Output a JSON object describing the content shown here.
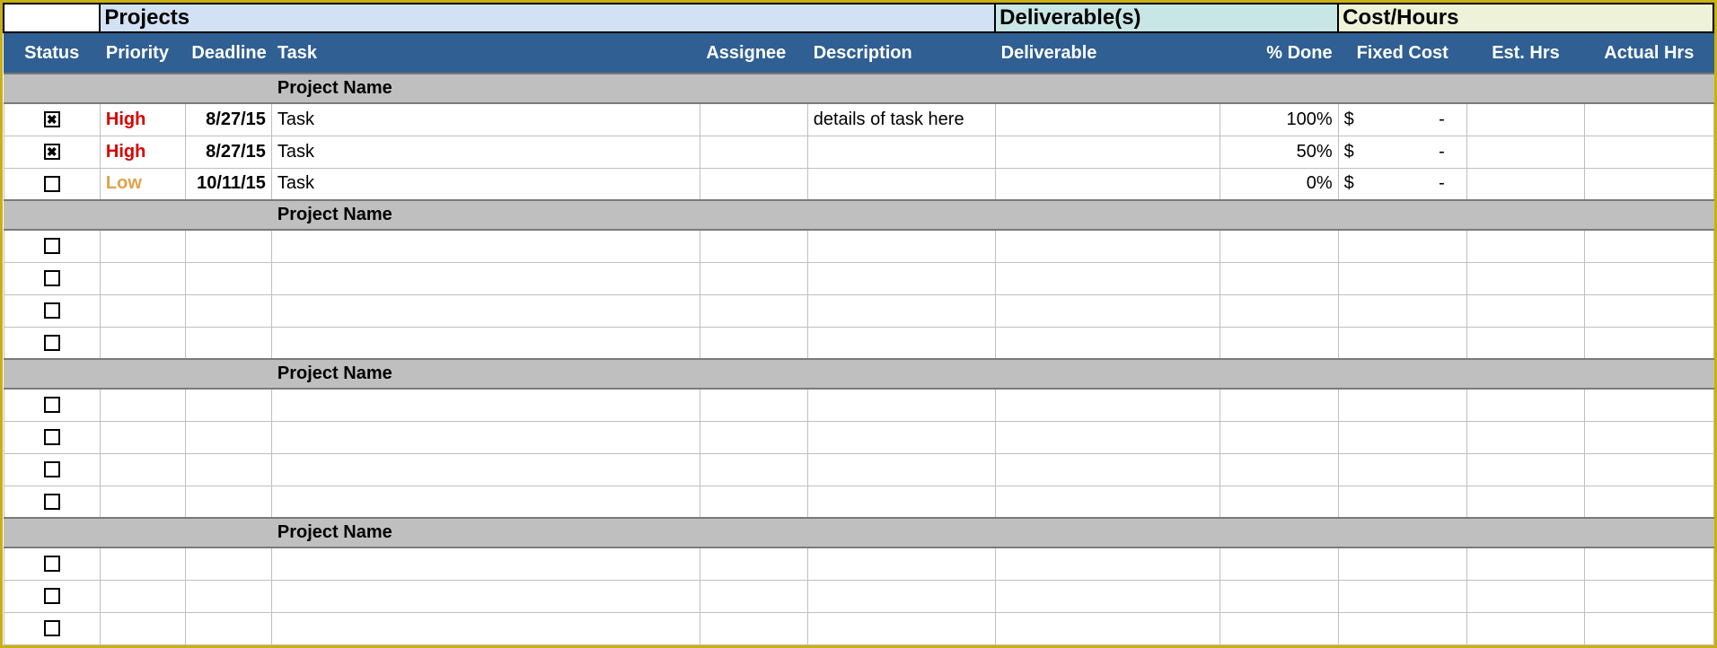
{
  "groupHeaders": {
    "projects": "Projects",
    "deliverables": "Deliverable(s)",
    "cost": "Cost/Hours"
  },
  "columns": {
    "status": "Status",
    "priority": "Priority",
    "deadline": "Deadline",
    "task": "Task",
    "assignee": "Assignee",
    "description": "Description",
    "deliverable": "Deliverable",
    "pctDone": "% Done",
    "fixedCost": "Fixed Cost",
    "estHrs": "Est. Hrs",
    "actualHrs": "Actual Hrs"
  },
  "sections": [
    {
      "name": "Project Name",
      "rows": [
        {
          "status": "checked",
          "priority": "High",
          "priorityClass": "high",
          "deadline": "8/27/15",
          "task": "Task",
          "assignee": "",
          "description": "details of task here",
          "deliverable": "",
          "pctDone": "100%",
          "fixedCurrency": "$",
          "fixedAmount": "-",
          "estHrs": "",
          "actualHrs": ""
        },
        {
          "status": "checked",
          "priority": "High",
          "priorityClass": "high",
          "deadline": "8/27/15",
          "task": "Task",
          "assignee": "",
          "description": "",
          "deliverable": "",
          "pctDone": "50%",
          "fixedCurrency": "$",
          "fixedAmount": "-",
          "estHrs": "",
          "actualHrs": ""
        },
        {
          "status": "unchecked",
          "priority": "Low",
          "priorityClass": "low",
          "deadline": "10/11/15",
          "task": "Task",
          "assignee": "",
          "description": "",
          "deliverable": "",
          "pctDone": "0%",
          "fixedCurrency": "$",
          "fixedAmount": "-",
          "estHrs": "",
          "actualHrs": ""
        }
      ]
    },
    {
      "name": "Project Name",
      "rows": [
        {
          "status": "unchecked",
          "priority": "",
          "priorityClass": "",
          "deadline": "",
          "task": "",
          "assignee": "",
          "description": "",
          "deliverable": "",
          "pctDone": "",
          "fixedCurrency": "",
          "fixedAmount": "",
          "estHrs": "",
          "actualHrs": ""
        },
        {
          "status": "unchecked",
          "priority": "",
          "priorityClass": "",
          "deadline": "",
          "task": "",
          "assignee": "",
          "description": "",
          "deliverable": "",
          "pctDone": "",
          "fixedCurrency": "",
          "fixedAmount": "",
          "estHrs": "",
          "actualHrs": ""
        },
        {
          "status": "unchecked",
          "priority": "",
          "priorityClass": "",
          "deadline": "",
          "task": "",
          "assignee": "",
          "description": "",
          "deliverable": "",
          "pctDone": "",
          "fixedCurrency": "",
          "fixedAmount": "",
          "estHrs": "",
          "actualHrs": ""
        },
        {
          "status": "unchecked",
          "priority": "",
          "priorityClass": "",
          "deadline": "",
          "task": "",
          "assignee": "",
          "description": "",
          "deliverable": "",
          "pctDone": "",
          "fixedCurrency": "",
          "fixedAmount": "",
          "estHrs": "",
          "actualHrs": ""
        }
      ]
    },
    {
      "name": "Project Name",
      "rows": [
        {
          "status": "unchecked",
          "priority": "",
          "priorityClass": "",
          "deadline": "",
          "task": "",
          "assignee": "",
          "description": "",
          "deliverable": "",
          "pctDone": "",
          "fixedCurrency": "",
          "fixedAmount": "",
          "estHrs": "",
          "actualHrs": ""
        },
        {
          "status": "unchecked",
          "priority": "",
          "priorityClass": "",
          "deadline": "",
          "task": "",
          "assignee": "",
          "description": "",
          "deliverable": "",
          "pctDone": "",
          "fixedCurrency": "",
          "fixedAmount": "",
          "estHrs": "",
          "actualHrs": ""
        },
        {
          "status": "unchecked",
          "priority": "",
          "priorityClass": "",
          "deadline": "",
          "task": "",
          "assignee": "",
          "description": "",
          "deliverable": "",
          "pctDone": "",
          "fixedCurrency": "",
          "fixedAmount": "",
          "estHrs": "",
          "actualHrs": ""
        },
        {
          "status": "unchecked",
          "priority": "",
          "priorityClass": "",
          "deadline": "",
          "task": "",
          "assignee": "",
          "description": "",
          "deliverable": "",
          "pctDone": "",
          "fixedCurrency": "",
          "fixedAmount": "",
          "estHrs": "",
          "actualHrs": ""
        }
      ]
    },
    {
      "name": "Project Name",
      "rows": [
        {
          "status": "unchecked",
          "priority": "",
          "priorityClass": "",
          "deadline": "",
          "task": "",
          "assignee": "",
          "description": "",
          "deliverable": "",
          "pctDone": "",
          "fixedCurrency": "",
          "fixedAmount": "",
          "estHrs": "",
          "actualHrs": ""
        },
        {
          "status": "unchecked",
          "priority": "",
          "priorityClass": "",
          "deadline": "",
          "task": "",
          "assignee": "",
          "description": "",
          "deliverable": "",
          "pctDone": "",
          "fixedCurrency": "",
          "fixedAmount": "",
          "estHrs": "",
          "actualHrs": ""
        },
        {
          "status": "unchecked",
          "priority": "",
          "priorityClass": "",
          "deadline": "",
          "task": "",
          "assignee": "",
          "description": "",
          "deliverable": "",
          "pctDone": "",
          "fixedCurrency": "",
          "fixedAmount": "",
          "estHrs": "",
          "actualHrs": ""
        }
      ]
    }
  ]
}
